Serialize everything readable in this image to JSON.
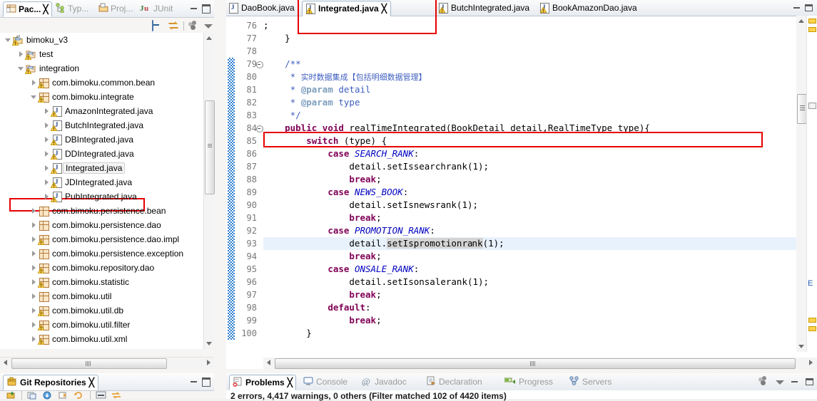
{
  "package_explorer": {
    "tabs": [
      {
        "label": "Pac...",
        "icon": "package-explorer-icon",
        "active": true,
        "closable": true
      },
      {
        "label": "Typ...",
        "icon": "type-hierarchy-icon",
        "active": false
      },
      {
        "label": "Proj...",
        "icon": "project-explorer-icon",
        "active": false
      },
      {
        "label": "JUnit",
        "icon": "junit-icon",
        "active": false
      }
    ],
    "window_buttons": [
      {
        "name": "minimize-view-button",
        "label": "Minimize"
      },
      {
        "name": "maximize-view-button",
        "label": "Maximize"
      }
    ],
    "toolbar": [
      {
        "name": "collapse-all-icon",
        "label": "Collapse All"
      },
      {
        "name": "link-with-editor-icon",
        "label": "Link with Editor"
      },
      {
        "name": "view-menu-icon",
        "label": "View Menu"
      },
      {
        "name": "view-menu-caret-icon",
        "label": "Menu"
      }
    ],
    "tree": [
      {
        "label": "bimoku_v3",
        "icon": "java-project-icon",
        "indent": 0,
        "arrow": "open",
        "warn": true
      },
      {
        "label": "test",
        "icon": "source-folder-icon",
        "indent": 1,
        "arrow": "closed",
        "warn": true
      },
      {
        "label": "integration",
        "icon": "source-folder-icon",
        "indent": 1,
        "arrow": "open",
        "warn": true
      },
      {
        "label": "com.bimoku.common.bean",
        "icon": "package-icon",
        "indent": 2,
        "arrow": "closed",
        "warn": true
      },
      {
        "label": "com.bimoku.integrate",
        "icon": "package-icon",
        "indent": 2,
        "arrow": "open",
        "warn": true
      },
      {
        "label": "AmazonIntegrated.java",
        "icon": "java-file-icon",
        "indent": 3,
        "arrow": "closed",
        "warn": true
      },
      {
        "label": "ButchIntegrated.java",
        "icon": "java-file-icon",
        "indent": 3,
        "arrow": "closed",
        "warn": true
      },
      {
        "label": "DBIntegrated.java",
        "icon": "java-file-icon",
        "indent": 3,
        "arrow": "closed",
        "warn": true
      },
      {
        "label": "DDIntegrated.java",
        "icon": "java-file-icon",
        "indent": 3,
        "arrow": "closed",
        "warn": true
      },
      {
        "label": "Integrated.java",
        "icon": "java-file-icon",
        "indent": 3,
        "arrow": "closed",
        "warn": true,
        "selected": true,
        "highlighted": true
      },
      {
        "label": "JDIntegrated.java",
        "icon": "java-file-icon",
        "indent": 3,
        "arrow": "closed",
        "warn": true
      },
      {
        "label": "PubIntegrated.java",
        "icon": "java-file-icon",
        "indent": 3,
        "arrow": "closed",
        "warn": true
      },
      {
        "label": "com.bimoku.persistence.bean",
        "icon": "package-icon",
        "indent": 2,
        "arrow": "closed",
        "warn": false
      },
      {
        "label": "com.bimoku.persistence.dao",
        "icon": "package-icon",
        "indent": 2,
        "arrow": "closed",
        "warn": false
      },
      {
        "label": "com.bimoku.persistence.dao.impl",
        "icon": "package-icon",
        "indent": 2,
        "arrow": "closed",
        "warn": true
      },
      {
        "label": "com.bimoku.persistence.exception",
        "icon": "package-icon",
        "indent": 2,
        "arrow": "closed",
        "warn": false
      },
      {
        "label": "com.bimoku.repository.dao",
        "icon": "package-icon",
        "indent": 2,
        "arrow": "closed",
        "warn": true
      },
      {
        "label": "com.bimoku.statistic",
        "icon": "package-icon",
        "indent": 2,
        "arrow": "closed",
        "warn": true
      },
      {
        "label": "com.bimoku.util",
        "icon": "package-icon",
        "indent": 2,
        "arrow": "closed",
        "warn": false
      },
      {
        "label": "com.bimoku.util.db",
        "icon": "package-icon",
        "indent": 2,
        "arrow": "closed",
        "warn": true
      },
      {
        "label": "com.bimoku.util.filter",
        "icon": "package-icon",
        "indent": 2,
        "arrow": "closed",
        "warn": true
      },
      {
        "label": "com.bimoku.util.xml",
        "icon": "package-icon",
        "indent": 2,
        "arrow": "closed",
        "warn": true
      }
    ]
  },
  "editor": {
    "tabs": [
      {
        "label": "DaoBook.java",
        "icon": "java-file-icon",
        "active": false,
        "warn": false
      },
      {
        "label": "Integrated.java",
        "icon": "java-file-icon",
        "active": true,
        "warn": true,
        "closable": true
      },
      {
        "label": "ButchIntegrated.java",
        "icon": "java-file-icon",
        "active": false,
        "warn": true
      },
      {
        "label": "BookAmazonDao.java",
        "icon": "java-file-icon",
        "active": false,
        "warn": true
      }
    ],
    "window_buttons": [
      {
        "name": "minimize-editor-button",
        "label": "Minimize"
      },
      {
        "name": "maximize-editor-button",
        "label": "Maximize"
      }
    ],
    "first_line_number": 76,
    "current_line": 93,
    "lines": [
      {
        "n": 76,
        "fold": false,
        "text": ";",
        "clipped": true
      },
      {
        "n": 77,
        "fold": false,
        "text": "    }"
      },
      {
        "n": 78,
        "fold": false,
        "text": ""
      },
      {
        "n": 79,
        "fold": true,
        "text": "    /**"
      },
      {
        "n": 80,
        "fold": false,
        "text": "     * 实时数据集成【包括明细数据管理】"
      },
      {
        "n": 81,
        "fold": false,
        "text": "     * @param detail"
      },
      {
        "n": 82,
        "fold": false,
        "text": "     * @param type"
      },
      {
        "n": 83,
        "fold": false,
        "text": "     */"
      },
      {
        "n": 84,
        "fold": true,
        "text": "    public void realTimeIntegrated(BookDetail detail,RealTimeType type){"
      },
      {
        "n": 85,
        "fold": false,
        "text": "        switch (type) {"
      },
      {
        "n": 86,
        "fold": false,
        "text": "            case SEARCH_RANK:"
      },
      {
        "n": 87,
        "fold": false,
        "text": "                detail.setIssearchrank(1);"
      },
      {
        "n": 88,
        "fold": false,
        "text": "                break;"
      },
      {
        "n": 89,
        "fold": false,
        "text": "            case NEWS_BOOK:"
      },
      {
        "n": 90,
        "fold": false,
        "text": "                detail.setIsnewsrank(1);"
      },
      {
        "n": 91,
        "fold": false,
        "text": "                break;"
      },
      {
        "n": 92,
        "fold": false,
        "text": "            case PROMOTION_RANK:"
      },
      {
        "n": 93,
        "fold": false,
        "text": "                detail.setIspromotionrank(1);"
      },
      {
        "n": 94,
        "fold": false,
        "text": "                break;"
      },
      {
        "n": 95,
        "fold": false,
        "text": "            case ONSALE_RANK:"
      },
      {
        "n": 96,
        "fold": false,
        "text": "                detail.setIsonsalerank(1);"
      },
      {
        "n": 97,
        "fold": false,
        "text": "                break;"
      },
      {
        "n": 98,
        "fold": false,
        "text": "            default:"
      },
      {
        "n": 99,
        "fold": false,
        "text": "                break;"
      },
      {
        "n": 100,
        "fold": false,
        "text": "        }"
      }
    ],
    "overview_marker_text": "E"
  },
  "git_view": {
    "tab_label": "Git Repositories",
    "tab_icon": "git-repository-icon",
    "closable": true,
    "window_buttons": [
      {
        "name": "minimize-git-view-button",
        "label": "Minimize"
      },
      {
        "name": "maximize-git-view-button",
        "label": "Maximize"
      }
    ]
  },
  "problems_view": {
    "tabs": [
      {
        "label": "Problems",
        "icon": "problems-icon",
        "active": true,
        "closable": true
      },
      {
        "label": "Console",
        "icon": "console-icon",
        "active": false
      },
      {
        "label": "Javadoc",
        "icon": "javadoc-icon",
        "active": false
      },
      {
        "label": "Declaration",
        "icon": "declaration-icon",
        "active": false
      },
      {
        "label": "Progress",
        "icon": "progress-icon",
        "active": false
      },
      {
        "label": "Servers",
        "icon": "servers-icon",
        "active": false
      }
    ],
    "status_text": "2 errors, 4,417 warnings, 0 others (Filter matched 102 of 4420 items)",
    "toolbar": [
      {
        "name": "view-menu-icon",
        "label": "View Menu"
      },
      {
        "name": "view-menu-caret-icon",
        "label": "Menu"
      },
      {
        "name": "minimize-problems-button",
        "label": "Minimize"
      },
      {
        "name": "maximize-problems-button",
        "label": "Maximize"
      }
    ]
  },
  "colors": {
    "accent": "#2a5db0",
    "highlight_red": "#e60000",
    "current_line": "#e8f2fd",
    "keyword": "#7f0055",
    "javadoc": "#3f5fbf",
    "javadoc_tag": "#7f9fbf",
    "constant": "#0000c0",
    "change_bar": "#2f7fd0",
    "warning_marker": "#ffd24d"
  }
}
